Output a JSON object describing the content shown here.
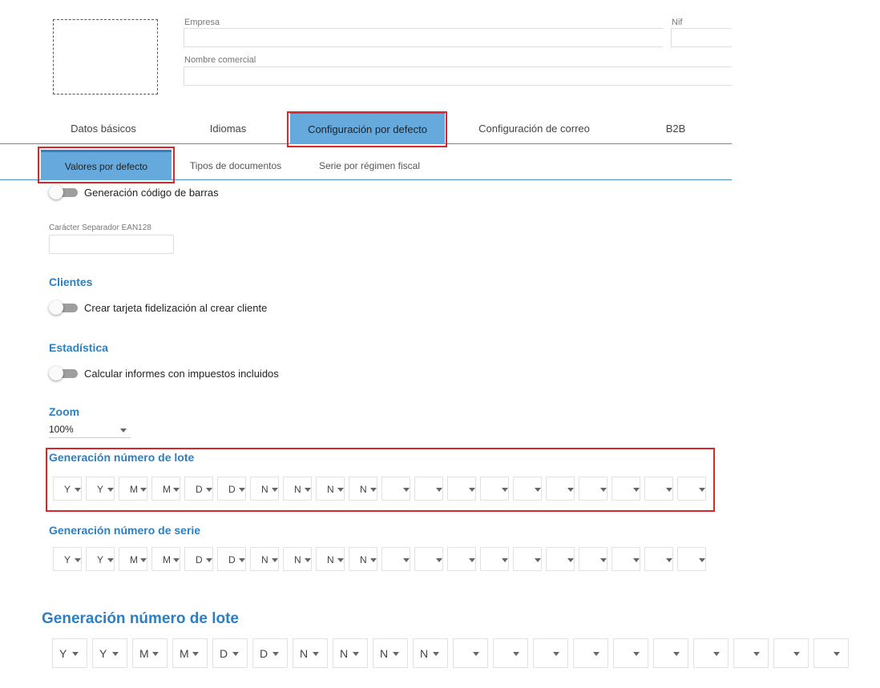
{
  "header": {
    "empresa_label": "Empresa",
    "empresa_value": "",
    "nif_label": "Nif",
    "nif_value": "",
    "nombre_comercial_label": "Nombre comercial",
    "nombre_comercial_value": ""
  },
  "tabs": [
    {
      "label": "Datos básicos",
      "active": false
    },
    {
      "label": "Idiomas",
      "active": false
    },
    {
      "label": "Configuración por defecto",
      "active": true
    },
    {
      "label": "Configuración de correo",
      "active": false
    },
    {
      "label": "B2B",
      "active": false
    }
  ],
  "subtabs": [
    {
      "label": "Valores por defecto",
      "active": true
    },
    {
      "label": "Tipos de documentos",
      "active": false
    },
    {
      "label": "Serie por régimen fiscal",
      "active": false
    }
  ],
  "barcode": {
    "toggle_label": "Generación código de barras",
    "toggle_on": false,
    "separator_label": "Carácter Separador EAN128",
    "separator_value": ""
  },
  "clientes": {
    "title": "Clientes",
    "toggle_label": "Crear tarjeta fidelización al crear cliente",
    "toggle_on": false
  },
  "estadistica": {
    "title": "Estadística",
    "toggle_label": "Calcular informes con impuestos incluidos",
    "toggle_on": false
  },
  "zoom": {
    "title": "Zoom",
    "value": "100%"
  },
  "lote": {
    "title": "Generación número de lote",
    "segments": [
      "Y",
      "Y",
      "M",
      "M",
      "D",
      "D",
      "N",
      "N",
      "N",
      "N",
      "",
      "",
      "",
      "",
      "",
      "",
      "",
      "",
      "",
      ""
    ]
  },
  "serie": {
    "title": "Generación número de serie",
    "segments": [
      "Y",
      "Y",
      "M",
      "M",
      "D",
      "D",
      "N",
      "N",
      "N",
      "N",
      "",
      "",
      "",
      "",
      "",
      "",
      "",
      "",
      "",
      ""
    ]
  },
  "lote_large": {
    "title": "Generación número de lote",
    "segments": [
      "Y",
      "Y",
      "M",
      "M",
      "D",
      "D",
      "N",
      "N",
      "N",
      "N",
      "",
      "",
      "",
      "",
      "",
      "",
      "",
      "",
      "",
      ""
    ]
  },
  "colors": {
    "accent": "#2d7fc1",
    "active_tab": "#66a9dd",
    "highlight": "#d9262a",
    "toggle_off": "#9e9e9e"
  },
  "icons": {
    "dropdown": "chevron-down-icon"
  }
}
